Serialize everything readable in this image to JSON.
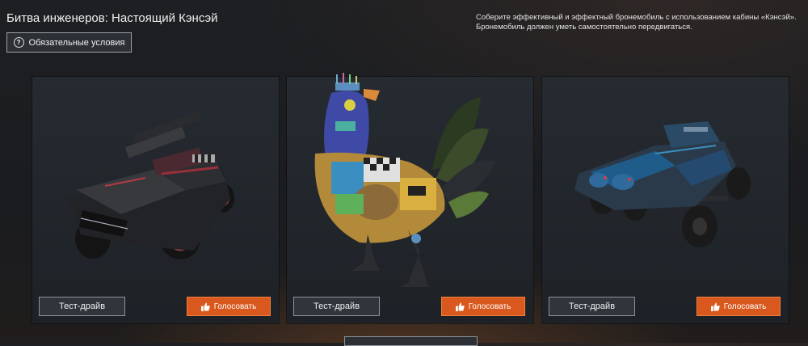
{
  "header": {
    "title": "Битва инженеров: Настоящий Кэнсэй",
    "requirements_label": "Обязательные условия",
    "description_line1": "Соберите эффективный и эффектный бронемобиль с использованием кабины «Кэнсэй».",
    "description_line2": "Бронемобиль должен уметь самостоятельно передвигаться."
  },
  "cards": [
    {
      "test_drive_label": "Тест-драйв",
      "vote_label": "Голосовать",
      "art": "black-armored-truck"
    },
    {
      "test_drive_label": "Тест-драйв",
      "vote_label": "Голосовать",
      "art": "rooster-vehicle"
    },
    {
      "test_drive_label": "Тест-драйв",
      "vote_label": "Голосовать",
      "art": "blue-armored-buggy"
    }
  ],
  "colors": {
    "accent": "#d9581e",
    "card_bg": "#23282e",
    "button_border": "#8e949a"
  }
}
